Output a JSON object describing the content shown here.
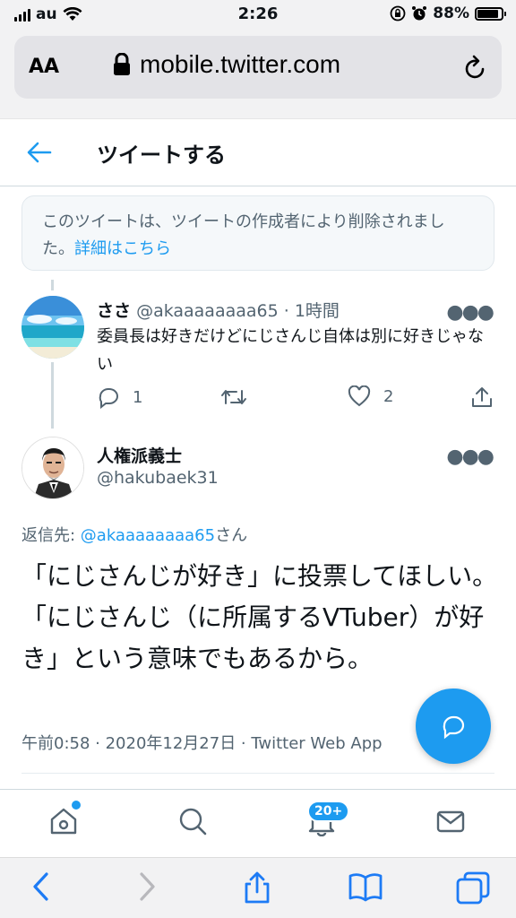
{
  "status_bar": {
    "carrier": "au",
    "time": "2:26",
    "battery": "88%",
    "battery_level": 0.88
  },
  "browser": {
    "text_size_label": "AA",
    "url": "mobile.twitter.com"
  },
  "header": {
    "title": "ツイートする"
  },
  "deleted_notice": {
    "text": "このツイートは、ツイートの作成者により削除されました。",
    "link": "詳細はこちら"
  },
  "tweet_reply": {
    "name": "ささ",
    "handle": "@akaaaaaaaa65",
    "separator": "·",
    "time": "1時間",
    "text": "委員長は好きだけどにじさんじ自体は別に好きじゃない",
    "reply_count": "1",
    "like_count": "2"
  },
  "tweet_main": {
    "name": "人権派義士",
    "handle": "@hakubaek31",
    "reply_label": "返信先: ",
    "reply_handle": "@akaaaaaaaa65",
    "reply_suffix": "さん",
    "text": "「にじさんじが好き」に投票してほしい。「にじさんじ（に所属するVTuber）が好き」という意味でもあるから。",
    "meta": "午前0:58 · 2020年12月27日 · Twitter Web App"
  },
  "nav": {
    "notification_badge": "20+"
  },
  "colors": {
    "accent": "#1d9bf0",
    "muted": "#536471",
    "text": "#0f1419"
  }
}
